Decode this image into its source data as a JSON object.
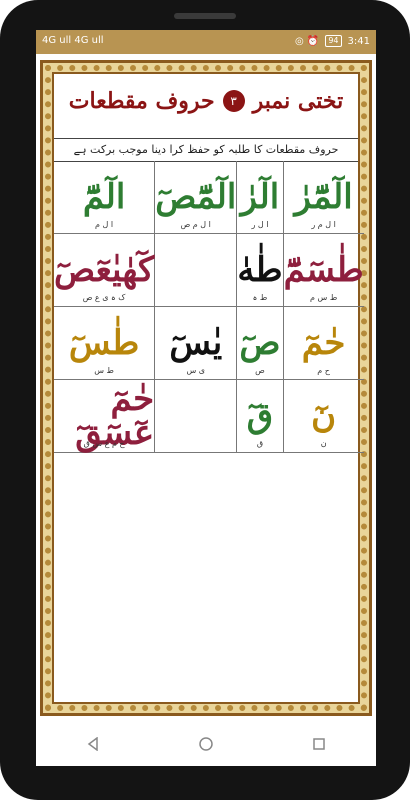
{
  "status_bar": {
    "left": "4G ull 4G ull",
    "right_icons": "◎ ⏰",
    "battery": "94",
    "time": "3:41"
  },
  "page": {
    "title": "تختی نمبر",
    "number": "۳",
    "title_right": "حروف مقطعات",
    "subtitle": "حروف مقطعات کا طلبہ کو حفظ کرا دینا موجب برکت ہے"
  },
  "grid": [
    {
      "glyph": "الٓمّٓ",
      "color": "#2e7d32",
      "sub": "ا ل م"
    },
    {
      "glyph": "الٓمّٓصٓ",
      "color": "#2e7d32",
      "sub": "ا ل م ص"
    },
    {
      "glyph": "الٓرٰ",
      "color": "#2e7d32",
      "sub": "ا ل ر"
    },
    {
      "glyph": "الٓمّٓرٰ",
      "color": "#2e7d32",
      "sub": "ا ل م ر"
    },
    {
      "glyph": "كٓهٰيٰعٓصٓ",
      "color": "#8e1f3d",
      "sub": "ک ہ ی ع ص"
    },
    {
      "glyph": "",
      "color": "#8e1f3d",
      "sub": ""
    },
    {
      "glyph": "طٰهٰ",
      "color": "#111111",
      "sub": "ط ہ"
    },
    {
      "glyph": "طٰسٓمّٓ",
      "color": "#8e1f3d",
      "sub": "ط س م"
    },
    {
      "glyph": "طٰسٓ",
      "color": "#b8860b",
      "sub": "ط س"
    },
    {
      "glyph": "يٰسٓ",
      "color": "#111111",
      "sub": "ی س"
    },
    {
      "glyph": "صٓ",
      "color": "#2e7d32",
      "sub": "ص"
    },
    {
      "glyph": "حٰمٓ",
      "color": "#b8860b",
      "sub": "ح م"
    },
    {
      "glyph": "حٰمٓ عٓسٓقٓ",
      "color": "#8e1f3d",
      "sub": "ح م ع س ق"
    },
    {
      "glyph": "",
      "color": "#2e7d32",
      "sub": ""
    },
    {
      "glyph": "قٓ",
      "color": "#2e7d32",
      "sub": "ق"
    },
    {
      "glyph": "نٓ",
      "color": "#b8860b",
      "sub": "ن"
    }
  ]
}
